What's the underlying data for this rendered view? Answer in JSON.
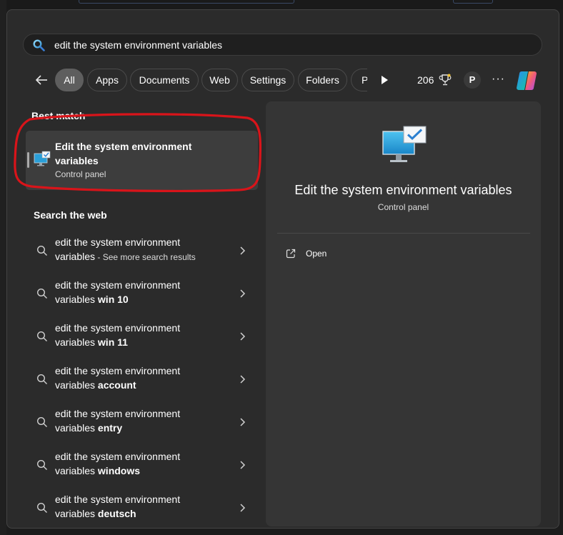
{
  "search": {
    "value": "edit the system environment variables"
  },
  "filters": {
    "chips": [
      {
        "label": "All",
        "active": true
      },
      {
        "label": "Apps"
      },
      {
        "label": "Documents"
      },
      {
        "label": "Web"
      },
      {
        "label": "Settings"
      },
      {
        "label": "Folders"
      },
      {
        "label": "Ph"
      }
    ],
    "points": "206",
    "avatar": "P",
    "more": "···"
  },
  "best_match": {
    "heading": "Best match",
    "title_line1": "Edit the system environment",
    "title_line2": "variables",
    "subtitle": "Control panel"
  },
  "web": {
    "heading": "Search the web",
    "items": [
      {
        "line1": "edit the system environment",
        "line2": "variables",
        "see_more": " - See more search results"
      },
      {
        "line1": "edit the system environment",
        "line2": "variables",
        "bold": " win 10"
      },
      {
        "line1": "edit the system environment",
        "line2": "variables",
        "bold": " win 11"
      },
      {
        "line1": "edit the system environment",
        "line2": "variables",
        "bold": " account"
      },
      {
        "line1": "edit the system environment",
        "line2": "variables",
        "bold": " entry"
      },
      {
        "line1": "edit the system environment",
        "line2": "variables",
        "bold": " windows"
      },
      {
        "line1": "edit the system environment",
        "line2": "variables",
        "bold": " deutsch"
      }
    ]
  },
  "preview": {
    "title": "Edit the system environment variables",
    "subtitle": "Control panel",
    "open_label": "Open"
  },
  "colors": {
    "flyout_bg": "#2b2b2b",
    "preview_bg": "#353535",
    "selected_bg": "#3d3d3d",
    "annotation_red": "#d9141a",
    "monitor_blue": "#2a9fd8"
  }
}
